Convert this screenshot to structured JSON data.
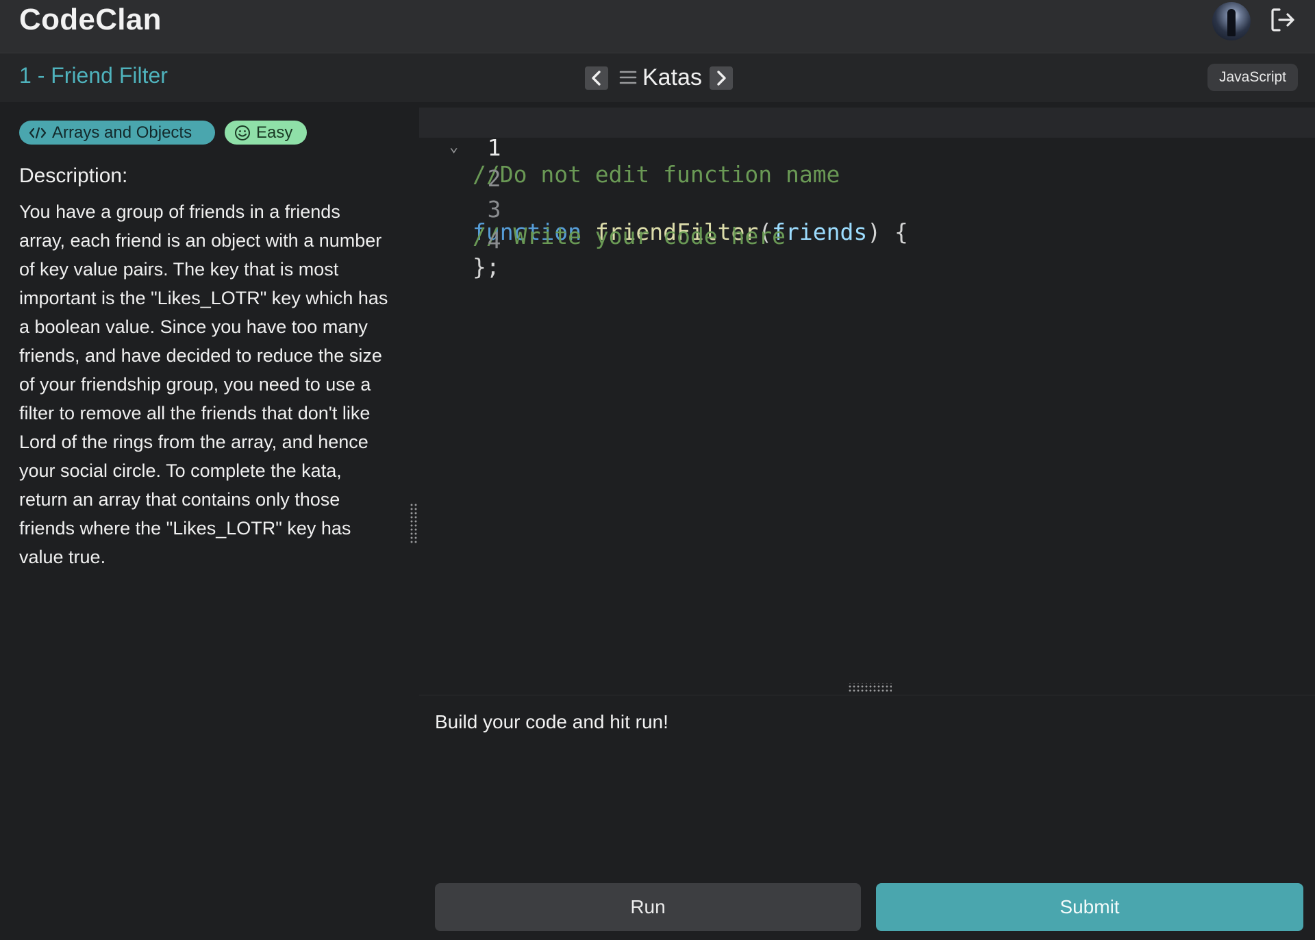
{
  "header": {
    "logo": "CodeClan"
  },
  "kata": {
    "title": "1 - Friend Filter",
    "tags": {
      "topic": "Arrays and Objects",
      "difficulty": "Easy"
    },
    "description_label": "Description:",
    "description": "You have a group of friends in a friends array, each friend is an object with a number of key value pairs. The key that is most important is the \"Likes_LOTR\" key which has a boolean value. Since you have too many friends, and have decided to reduce the size of your friendship group, you need to use a filter to remove all the friends that don't like Lord of the rings from the array, and hence your social circle. To complete the kata, return an array that contains only those friends where the \"Likes_LOTR\" key has value true."
  },
  "toolbar": {
    "section_label": "Katas",
    "language": "JavaScript"
  },
  "editor": {
    "lines": [
      {
        "number": "1",
        "text": "//Do not edit function name"
      },
      {
        "number": "2",
        "keyword": "function",
        "fn_name": "friendFilter",
        "param": "friends",
        "open_paren": "(",
        "close_rest": ") {"
      },
      {
        "number": "3",
        "text": "// Write your code here"
      },
      {
        "number": "4",
        "text": "};"
      }
    ]
  },
  "output": {
    "message": "Build your code and hit run!"
  },
  "actions": {
    "run_label": "Run",
    "submit_label": "Submit"
  },
  "colors": {
    "accent": "#4aa6ae",
    "difficulty_easy": "#8fe0a8",
    "background": "#1e1f21",
    "header": "#2d2e30"
  },
  "icons": [
    "logout-icon",
    "chevron-left-icon",
    "chevron-right-icon",
    "menu-icon",
    "code-icon",
    "smiley-icon"
  ]
}
